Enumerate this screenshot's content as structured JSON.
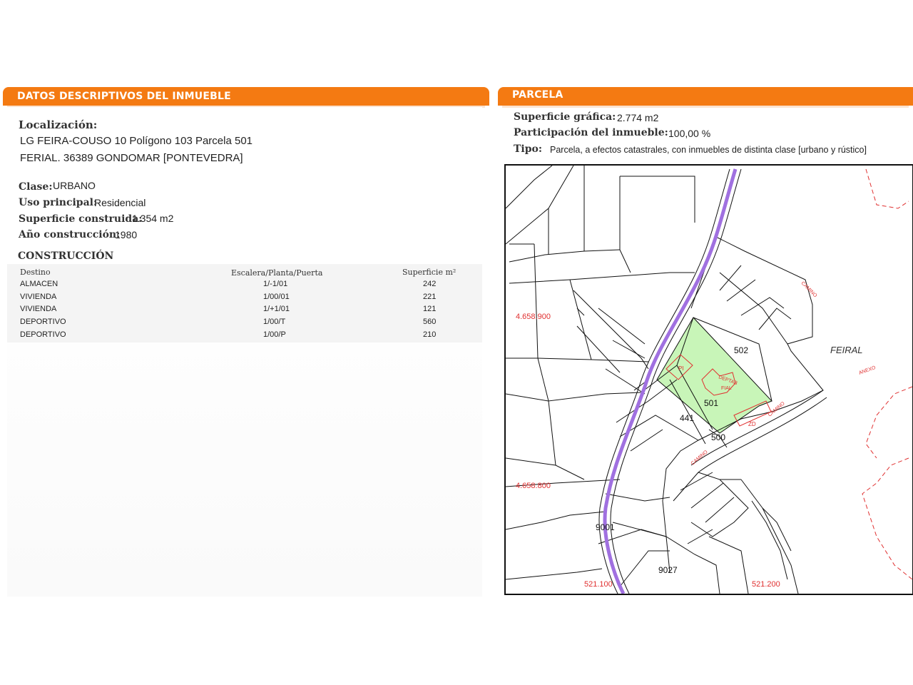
{
  "left_panel": {
    "header": "DATOS DESCRIPTIVOS DEL INMUEBLE",
    "localizacion_label": "Localización:",
    "address_line1": "LG FEIRA-COUSO 10 Polígono 103 Parcela 501",
    "address_line2": "FERIAL. 36389 GONDOMAR [PONTEVEDRA]",
    "clase_label": "Clase:",
    "clase_value": "URBANO",
    "uso_label": "Uso principal:",
    "uso_value": "Residencial",
    "superficie_label": "Superficie construida:",
    "superficie_value": "1.354 m2",
    "ano_label": "Año construcción:",
    "ano_value": "1980",
    "construccion_title": "CONSTRUCCIÓN",
    "table": {
      "headers": [
        "Destino",
        "Escalera/Planta/Puerta",
        "Superficie m²"
      ],
      "rows": [
        [
          "ALMACEN",
          "1/-1/01",
          "242"
        ],
        [
          "VIVIENDA",
          "1/00/01",
          "221"
        ],
        [
          "VIVIENDA",
          "1/+1/01",
          "121"
        ],
        [
          "DEPORTIVO",
          "1/00/T",
          "560"
        ],
        [
          "DEPORTIVO",
          "1/00/P",
          "210"
        ]
      ]
    }
  },
  "right_panel": {
    "header": "PARCELA",
    "superficie_grafica_label": "Superficie gráfica:",
    "superficie_grafica_value": "2.774 m2",
    "participacion_label": "Participación del inmueble:",
    "participacion_value": "100,00 %",
    "tipo_label": "Tipo:",
    "tipo_value": "Parcela, a efectos catastrales, con inmuebles de distinta clase [urbano y rústico]"
  },
  "map": {
    "coord_y1": "4.658.900",
    "coord_y2": "4.658.800",
    "coord_x1": "521.100",
    "coord_x2": "521.200",
    "place_name": "FEIRAL",
    "parcel_main": "501",
    "parcel_502": "502",
    "parcel_441": "441",
    "parcel_500": "500",
    "parcel_9001": "9001",
    "parcel_9027": "9027",
    "label_pi": "PI",
    "label_zd": "ZD",
    "label_camino1": "CAMINO",
    "label_camino2": "CAMINO",
    "label_camino3": "CAMINO",
    "label_anexo": "ANEXO",
    "building_label1": "DEPTAB",
    "building_label2": "FIAL",
    "highlight_color": "#c8f5b8",
    "road_color": "#a070e0"
  }
}
